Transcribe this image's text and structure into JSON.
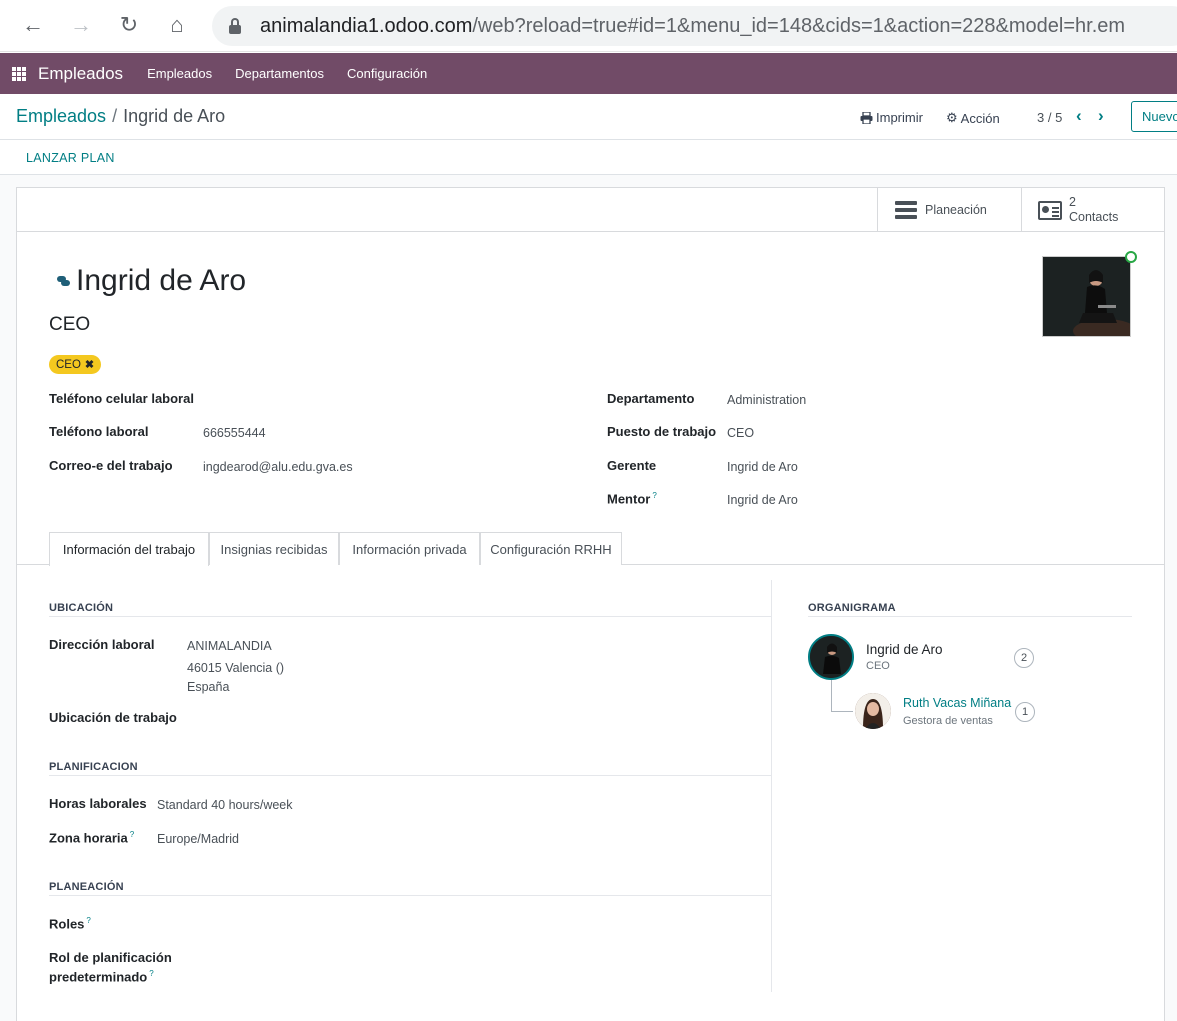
{
  "browser": {
    "url_domain": "animalandia1.odoo.com",
    "url_path": "/web?reload=true#id=1&menu_id=148&cids=1&action=228&model=hr.em"
  },
  "navbar": {
    "app_name": "Empleados",
    "menu": [
      "Empleados",
      "Departamentos",
      "Configuración"
    ]
  },
  "control_panel": {
    "breadcrumb_parent": "Empleados",
    "breadcrumb_sep": "/",
    "breadcrumb_current": "Ingrid de Aro",
    "print_label": "Imprimir",
    "action_label": "Acción",
    "pager": "3 / 5",
    "new_label": "Nuevo"
  },
  "statusbar": {
    "launch_plan": "LANZAR PLAN"
  },
  "smart_buttons": {
    "planning_label": "Planeación",
    "contacts_count": "2",
    "contacts_label": "Contacts"
  },
  "employee": {
    "name": "Ingrid de Aro",
    "job_title": "CEO",
    "tag": "CEO",
    "tag_remove": "✖"
  },
  "fields_left": [
    {
      "label": "Teléfono celular laboral",
      "value": ""
    },
    {
      "label": "Teléfono laboral",
      "value": "666555444"
    },
    {
      "label": "Correo-e del trabajo",
      "value": "ingdearod@alu.edu.gva.es"
    }
  ],
  "fields_right": [
    {
      "label": "Departamento",
      "value": "Administration"
    },
    {
      "label": "Puesto de trabajo",
      "value": "CEO"
    },
    {
      "label": "Gerente",
      "value": "Ingrid de Aro"
    },
    {
      "label": "Mentor",
      "help": "?",
      "value": "Ingrid de Aro"
    }
  ],
  "tabs": [
    "Información del trabajo",
    "Insignias recibidas",
    "Información privada",
    "Configuración RRHH"
  ],
  "ubicacion": {
    "title": "UBICACIÓN",
    "address_label": "Dirección laboral",
    "address_lines": [
      "ANIMALANDIA",
      "46015 Valencia ()",
      "España"
    ],
    "work_location_label": "Ubicación de trabajo"
  },
  "planificacion": {
    "title": "PLANIFICACION",
    "hours_label": "Horas laborales",
    "hours_value": "Standard 40 hours/week",
    "tz_label": "Zona horaria",
    "tz_help": "?",
    "tz_value": "Europe/Madrid"
  },
  "planeacion": {
    "title": "PLANEACIÓN",
    "roles_label": "Roles",
    "roles_help": "?",
    "default_role_label_1": "Rol de planificación",
    "default_role_label_2": "predeterminado",
    "default_role_help": "?"
  },
  "organigram": {
    "title": "ORGANIGRAMA",
    "main_name": "Ingrid de Aro",
    "main_job": "CEO",
    "main_count": "2",
    "sub_name": "Ruth Vacas Miñana",
    "sub_job": "Gestora de ventas",
    "sub_count": "1"
  },
  "colors": {
    "brand": "#714b67",
    "link": "#017e84",
    "tag": "#f4c81f",
    "presence": "#28a745"
  }
}
